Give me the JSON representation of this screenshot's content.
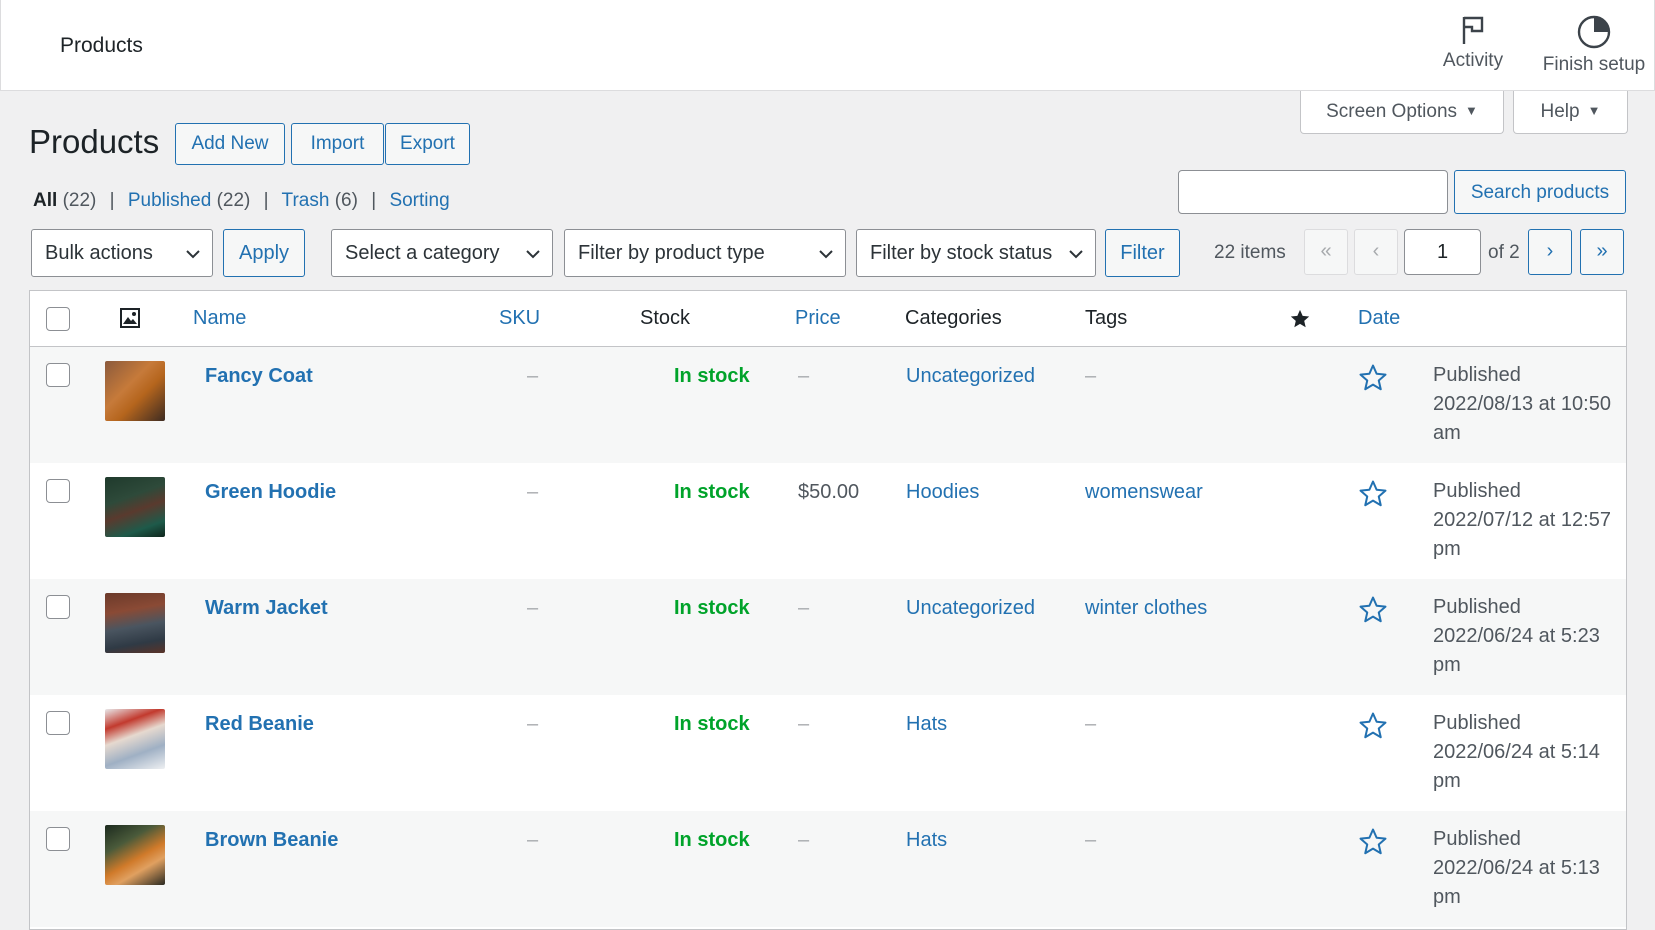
{
  "header": {
    "title": "Products",
    "activity_label": "Activity",
    "finish_setup_label": "Finish setup"
  },
  "tabs": {
    "screen_options": "Screen Options",
    "help": "Help"
  },
  "page": {
    "title": "Products",
    "add_new": "Add New",
    "import": "Import",
    "export": "Export"
  },
  "views": {
    "all": "All",
    "all_count": "(22)",
    "published": "Published",
    "published_count": "(22)",
    "trash": "Trash",
    "trash_count": "(6)",
    "sorting": "Sorting"
  },
  "search": {
    "value": "",
    "button": "Search products"
  },
  "filters": {
    "bulk_actions": "Bulk actions",
    "apply": "Apply",
    "category": "Select a category",
    "product_type": "Filter by product type",
    "stock_status": "Filter by stock status",
    "filter": "Filter"
  },
  "pagination": {
    "items": "22 items",
    "first": "«",
    "prev": "‹",
    "current": "1",
    "of_total": "of 2",
    "next": "›",
    "last": "»"
  },
  "table": {
    "columns": {
      "name": "Name",
      "sku": "SKU",
      "stock": "Stock",
      "price": "Price",
      "categories": "Categories",
      "tags": "Tags",
      "date": "Date"
    },
    "rows": [
      {
        "name": "Fancy Coat",
        "sku": "–",
        "stock": "In stock",
        "price": "–",
        "categories": "Uncategorized",
        "tags": "–",
        "date_1": "Published",
        "date_2": "2022/08/13 at 10:50",
        "date_3": "am"
      },
      {
        "name": "Green Hoodie",
        "sku": "–",
        "stock": "In stock",
        "price": "$50.00",
        "categories": "Hoodies",
        "tags": "womenswear",
        "date_1": "Published",
        "date_2": "2022/07/12 at 12:57",
        "date_3": "pm"
      },
      {
        "name": "Warm Jacket",
        "sku": "–",
        "stock": "In stock",
        "price": "–",
        "categories": "Uncategorized",
        "tags": "winter clothes",
        "date_1": "Published",
        "date_2": "2022/06/24 at 5:23",
        "date_3": "pm"
      },
      {
        "name": "Red Beanie",
        "sku": "–",
        "stock": "In stock",
        "price": "–",
        "categories": "Hats",
        "tags": "–",
        "date_1": "Published",
        "date_2": "2022/06/24 at 5:14",
        "date_3": "pm"
      },
      {
        "name": "Brown Beanie",
        "sku": "–",
        "stock": "In stock",
        "price": "–",
        "categories": "Hats",
        "tags": "–",
        "date_1": "Published",
        "date_2": "2022/06/24 at 5:13",
        "date_3": "pm"
      }
    ]
  },
  "colors": {
    "link": "#2271b1",
    "in_stock": "#00a32a",
    "background": "#f0f0f1"
  }
}
